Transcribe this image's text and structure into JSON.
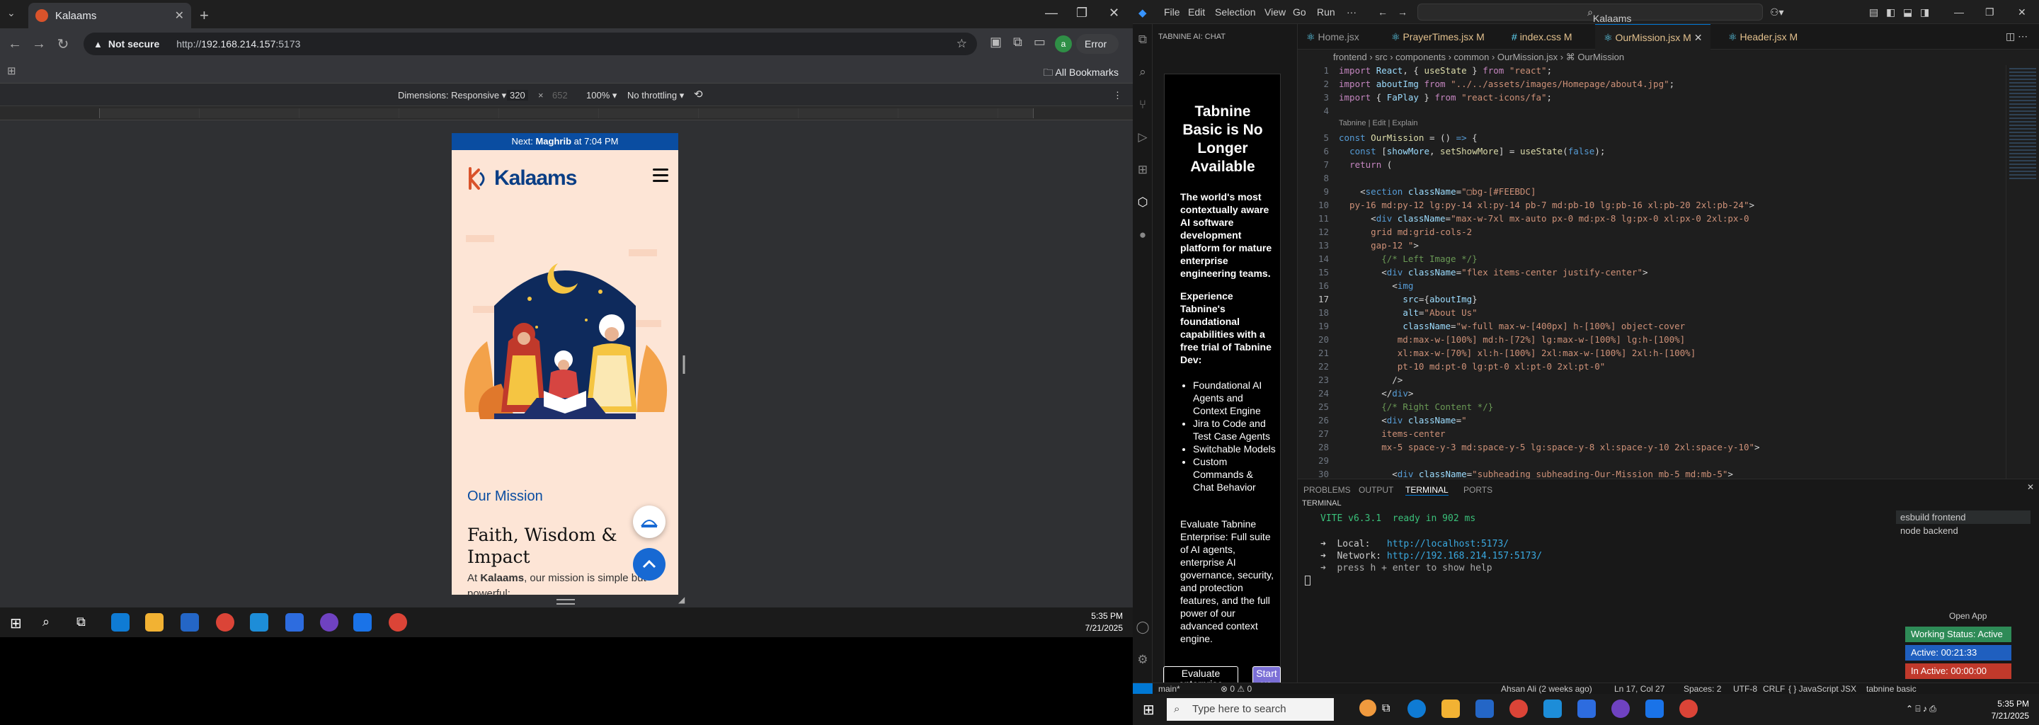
{
  "chrome": {
    "tab_title": "Kalaams",
    "omnibox_security": "Not secure",
    "omnibox_url_prefix": "http://",
    "omnibox_host": "192.168.214.157",
    "omnibox_port": ":5173",
    "error_label": "Error",
    "profile_initial": "a",
    "bookmarks_label": "All Bookmarks",
    "devtools": {
      "dimensions": "Dimensions: Responsive ▾",
      "width": "320",
      "times": "×",
      "height": "652",
      "zoom": "100% ▾",
      "throttle": "No throttling ▾"
    }
  },
  "site": {
    "prayer_prefix": "Next: ",
    "prayer_name": "Maghrib",
    "prayer_time": " at 7:04 PM",
    "brand": "Kalaams",
    "mission_label": "Our Mission",
    "mission_title": "Faith, Wisdom & Impact",
    "mission_text_a": "At ",
    "mission_text_b": "Kalaams",
    "mission_text_c": ", our mission is simple but powerful:"
  },
  "taskbar_left": {
    "time": "5:35 PM",
    "date": "7/21/2025"
  },
  "vscode": {
    "menu": [
      "File",
      "Edit",
      "Selection",
      "View",
      "Go",
      "Run",
      "···"
    ],
    "search": "Kalaams",
    "chat_header": "TABNINE AI: CHAT",
    "card": {
      "heading": "Tabnine Basic is No Longer Available",
      "p1": "The world's most contextually aware AI software development platform for mature enterprise engineering teams.",
      "p2": "Experience Tabnine's foundational capabilities with a free trial of Tabnine Dev:",
      "bullets": [
        "Foundational AI Agents and Context Engine",
        "Jira to Code and Test Case Agents",
        "Switchable Models",
        "Custom Commands & Chat Behavior"
      ],
      "p3": "Evaluate Tabnine Enterprise: Full suite of AI agents, enterprise AI governance, security, and protection features, and the full power of our advanced context engine.",
      "btn1": "Evaluate enterprise",
      "btn2": "Start yo Dev tria"
    },
    "tabs": [
      "Home.jsx",
      "PrayerTimes.jsx M",
      "index.css M",
      "OurMission.jsx M",
      "Header.jsx M"
    ],
    "active_tab_index": 3,
    "breadcrumb": "frontend  ›  src  ›  components  ›  common  ›  OurMission.jsx  ›  ⌘ OurMission",
    "codelens": "Tabnine | Edit | Explain",
    "line_numbers": [
      "1",
      "2",
      "3",
      "4",
      "5",
      "6",
      "7",
      "8",
      "9",
      "10",
      "11",
      "12",
      "13",
      "14",
      "15",
      "16",
      "17",
      "18",
      "19",
      "20",
      "21",
      "22",
      "23",
      "24",
      "25",
      "26",
      "27",
      "28",
      "29",
      "30"
    ],
    "panel_tabs": [
      "PROBLEMS",
      "OUTPUT",
      "TERMINAL",
      "PORTS"
    ],
    "terminal_label": "TERMINAL",
    "terminal": {
      "vite": "VITE v6.3.1  ready in 902 ms",
      "local_label": "➜  Local:   ",
      "local_url": "http://localhost:5173/",
      "network_label": "➜  Network: ",
      "network_url": "http://192.168.214.157:5173/",
      "help": "➜  press h + enter to show help"
    },
    "terminals": [
      "esbuild  frontend",
      "node  backend"
    ],
    "open_app": "Open App",
    "status_boxes": [
      "Working Status: Active",
      "Active: 00:21:33",
      "In Active: 00:00:00"
    ],
    "status": {
      "branch": "main*",
      "problems": "⊗ 0 ⚠ 0",
      "blame": "Ahsan Ali (2 weeks ago)",
      "pos": "Ln 17, Col 27",
      "spaces": "Spaces: 2",
      "enc": "UTF-8",
      "eol": "CRLF",
      "lang": "{ } JavaScript JSX",
      "tabnine": "tabnine basic"
    }
  },
  "taskbar_right": {
    "search": "Type here to search",
    "time": "5:35 PM",
    "date": "7/21/2025"
  },
  "colors": {
    "accent": "#0078d4",
    "site_blue": "#0a4da1",
    "site_bg": "#fde5d6",
    "working": "#2e8b57",
    "active": "#1f5fbf",
    "inactive": "#c0392b"
  }
}
